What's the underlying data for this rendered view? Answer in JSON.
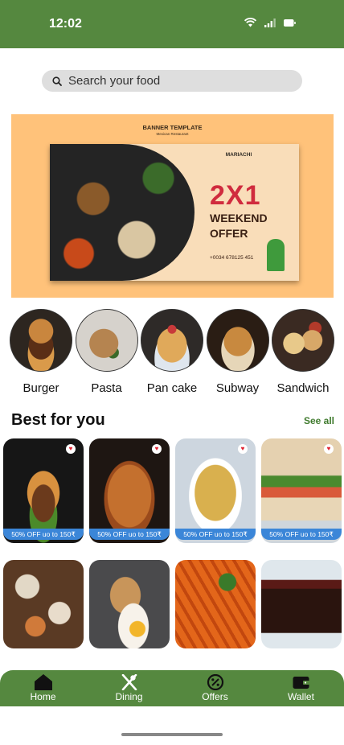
{
  "status_bar": {
    "time": "12:02"
  },
  "search": {
    "placeholder": "Search your food"
  },
  "banner": {
    "heading": "BANNER TEMPLATE",
    "subheading": "Mexican Restaurant",
    "brand": "MARIACHI",
    "big_text": "2X1",
    "line1": "WEEKEND",
    "line2": "OFFER",
    "phone": "+0034 678125 451"
  },
  "categories": [
    {
      "label": "Burger"
    },
    {
      "label": "Pasta"
    },
    {
      "label": "Pan cake"
    },
    {
      "label": "Subway"
    },
    {
      "label": "Sandwich"
    }
  ],
  "best_for_you": {
    "title": "Best for you",
    "see_all": "See all",
    "row1": [
      {
        "offer": "50% OFF uo to 150₹"
      },
      {
        "offer": "50% OFF uo to 150₹"
      },
      {
        "offer": "50% OFF uo to 150₹"
      },
      {
        "offer": "50% OFF uo to 150₹"
      }
    ]
  },
  "nav": [
    {
      "label": "Home",
      "icon": "home-icon"
    },
    {
      "label": "Dining",
      "icon": "dining-icon"
    },
    {
      "label": "Offers",
      "icon": "offers-icon"
    },
    {
      "label": "Wallet",
      "icon": "wallet-icon"
    }
  ],
  "colors": {
    "brand_green": "#55883f",
    "search_bg": "#dedede",
    "banner_bg": "#ffc27a",
    "offer_blue": "#3b86d8",
    "see_all": "#3f7a2d"
  }
}
